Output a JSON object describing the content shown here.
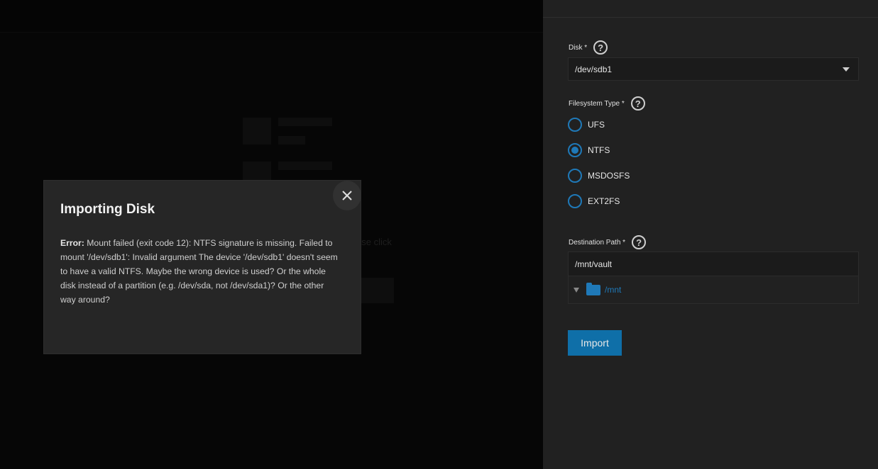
{
  "background": {
    "partial_text": "ase click"
  },
  "panel": {
    "disk": {
      "label": "Disk *",
      "value": "/dev/sdb1"
    },
    "filesystem": {
      "label": "Filesystem Type *",
      "options": [
        "UFS",
        "NTFS",
        "MSDOSFS",
        "EXT2FS"
      ],
      "selected": "NTFS"
    },
    "destination": {
      "label": "Destination Path *",
      "value": "/mnt/vault",
      "tree_root": "/mnt"
    },
    "import_label": "Import"
  },
  "dialog": {
    "title": "Importing Disk",
    "error_prefix": "Error:",
    "error_text": " Mount failed (exit code 12): NTFS signature is missing. Failed to mount '/dev/sdb1': Invalid argument The device '/dev/sdb1' doesn't seem to have a valid NTFS. Maybe the wrong device is used? Or the whole disk instead of a partition (e.g. /dev/sda, not /dev/sda1)? Or the other way around?"
  },
  "colors": {
    "accent": "#1f79b8",
    "button": "#0f6fa8",
    "panel_bg": "#212121",
    "dialog_bg": "#262626"
  }
}
